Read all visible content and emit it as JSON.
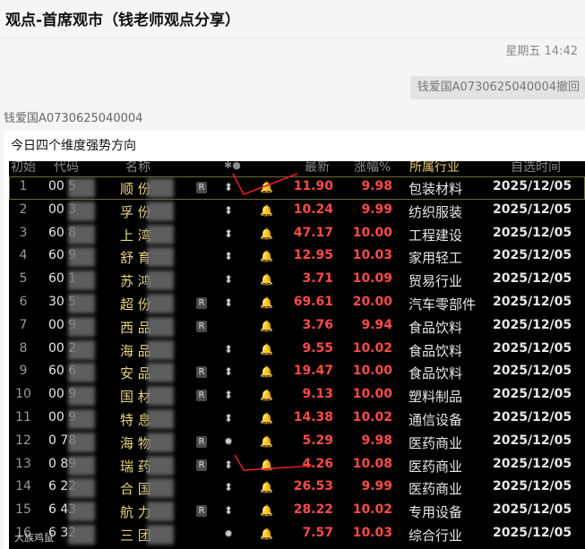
{
  "window": {
    "title": "观点-首席观市（钱老师观点分享）"
  },
  "chat": {
    "time": "星期五 14:42",
    "sent_chip": "钱爱国A0730625040004撤回",
    "sender": "钱爱国A0730625040004",
    "message": "今日四个维度强势方向"
  },
  "table": {
    "headers": {
      "index": "初始",
      "code": "代码",
      "name": "名称",
      "icons": "✱●",
      "price": "最新",
      "pct": "涨幅%",
      "industry": "所属行业",
      "date": "自选时间"
    },
    "rows": [
      {
        "idx": "1",
        "code": "00   5",
        "name": "顺   份",
        "tag": "R",
        "icon": "⬍",
        "price": "11.90",
        "pct": "9.98",
        "industry": "包装材料",
        "date": "2025/12/05"
      },
      {
        "idx": "2",
        "code": "00   3",
        "name": "孚   份",
        "tag": "",
        "icon": "⬍",
        "price": "10.24",
        "pct": "9.99",
        "industry": "纺织服装",
        "date": "2025/12/05"
      },
      {
        "idx": "3",
        "code": "60   8",
        "name": "上   湾",
        "tag": "",
        "icon": "⬍",
        "price": "47.17",
        "pct": "10.00",
        "industry": "工程建设",
        "date": "2025/12/05"
      },
      {
        "idx": "4",
        "code": "60   9",
        "name": "舒   育",
        "tag": "",
        "icon": "⬍",
        "price": "12.95",
        "pct": "10.03",
        "industry": "家用轻工",
        "date": "2025/12/05"
      },
      {
        "idx": "5",
        "code": "60   1",
        "name": "苏   鸿",
        "tag": "",
        "icon": "⬍",
        "price": "3.71",
        "pct": "10.09",
        "industry": "贸易行业",
        "date": "2025/12/05"
      },
      {
        "idx": "6",
        "code": "30   5",
        "name": "超   份",
        "tag": "R",
        "icon": "⬍",
        "price": "69.61",
        "pct": "20.00",
        "industry": "汽车零部件",
        "date": "2025/12/05"
      },
      {
        "idx": "7",
        "code": "00   9",
        "name": "西   品",
        "tag": "R",
        "icon": "",
        "price": "3.76",
        "pct": "9.94",
        "industry": "食品饮料",
        "date": "2025/12/05"
      },
      {
        "idx": "8",
        "code": "00   2",
        "name": "海   品",
        "tag": "",
        "icon": "⬍",
        "price": "9.55",
        "pct": "10.02",
        "industry": "食品饮料",
        "date": "2025/12/05"
      },
      {
        "idx": "9",
        "code": "60   6",
        "name": "安   品",
        "tag": "R",
        "icon": "⬍",
        "price": "19.47",
        "pct": "10.00",
        "industry": "食品饮料",
        "date": "2025/12/05"
      },
      {
        "idx": "10",
        "code": "00   9",
        "name": "国   材",
        "tag": "R",
        "icon": "⬍",
        "price": "9.13",
        "pct": "10.00",
        "industry": "塑料制品",
        "date": "2025/12/05"
      },
      {
        "idx": "11",
        "code": "00   9",
        "name": "特   息",
        "tag": "",
        "icon": "⬍",
        "price": "14.38",
        "pct": "10.02",
        "industry": "通信设备",
        "date": "2025/12/05"
      },
      {
        "idx": "12",
        "code": "0   78",
        "name": "海   物",
        "tag": "R",
        "icon": "✹",
        "price": "5.29",
        "pct": "9.98",
        "industry": "医药商业",
        "date": "2025/12/05"
      },
      {
        "idx": "13",
        "code": "0   89",
        "name": "瑞   药",
        "tag": "R",
        "icon": "⬍",
        "price": "4.26",
        "pct": "10.08",
        "industry": "医药商业",
        "date": "2025/12/05"
      },
      {
        "idx": "14",
        "code": "6   22",
        "name": "合   国",
        "tag": "",
        "icon": "⬍",
        "price": "26.53",
        "pct": "9.99",
        "industry": "医药商业",
        "date": "2025/12/05"
      },
      {
        "idx": "15",
        "code": "6   43",
        "name": "航   力",
        "tag": "R",
        "icon": "⬍",
        "price": "28.22",
        "pct": "10.02",
        "industry": "专用设备",
        "date": "2025/12/05"
      },
      {
        "idx": "16",
        "code": "6   32",
        "name": "三   团",
        "tag": "",
        "icon": "✹",
        "price": "7.57",
        "pct": "10.03",
        "industry": "综合行业",
        "date": "2025/12/05"
      }
    ]
  },
  "watermark": "大族鸡鼠",
  "colors": {
    "up": "#ff4a4a",
    "name": "#e8d780",
    "background": "#000000"
  }
}
